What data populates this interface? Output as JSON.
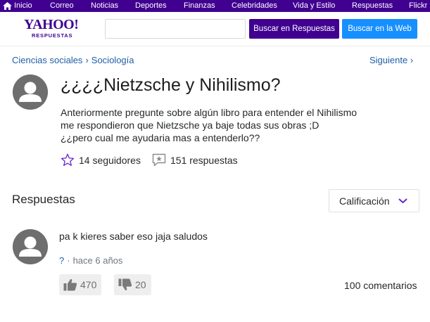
{
  "topnav": {
    "items": [
      {
        "label": "Inicio",
        "icon": "home-icon"
      },
      {
        "label": "Correo"
      },
      {
        "label": "Noticias"
      },
      {
        "label": "Deportes"
      },
      {
        "label": "Finanzas"
      },
      {
        "label": "Celebridades"
      },
      {
        "label": "Vida y Estilo"
      },
      {
        "label": "Respuestas"
      },
      {
        "label": "Flickr"
      }
    ]
  },
  "header": {
    "logo_text": "YAHOO!",
    "logo_sub": "RESPUESTAS",
    "search_value": "",
    "search_answers_label": "Buscar en Respuestas",
    "search_web_label": "Buscar en la Web"
  },
  "breadcrumb": {
    "items": [
      "Ciencias sociales",
      "Sociología"
    ],
    "separator": "›",
    "next_label": "Siguiente ›"
  },
  "question": {
    "title": "¿¿¿¿Nietzsche y Nihilismo?",
    "body_lines": [
      "Anteriormente pregunte sobre algún libro para entender el Nihilismo",
      "me respondieron que Nietzsche ya baje todas sus obras ;D",
      "¿¿pero cual me ayudaria mas a entenderlo??"
    ],
    "followers": "14 seguidores",
    "answers_count": "151 respuestas"
  },
  "answers": {
    "heading": "Respuestas",
    "sort_label": "Calificación",
    "items": [
      {
        "text": "pa k kieres saber eso jaja saludos",
        "user": "?",
        "meta_sep": "·",
        "time": "hace 6 años",
        "upvotes": "470",
        "downvotes": "20",
        "comments": "100 comentarios"
      }
    ]
  },
  "colors": {
    "nav_bg": "#400090",
    "brand_purple": "#400090",
    "web_button": "#188fff",
    "link": "#1e5fa6",
    "star": "#6a28c8"
  }
}
